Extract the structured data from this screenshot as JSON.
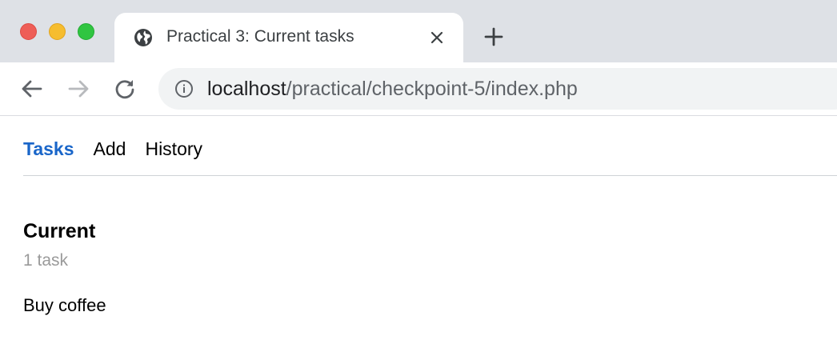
{
  "browser": {
    "tab": {
      "title": "Practical 3: Current tasks",
      "favicon": "globe-icon",
      "close_icon": "close-icon"
    },
    "new_tab_icon": "plus-icon",
    "nav": {
      "back_icon": "arrow-left-icon",
      "forward_icon": "arrow-right-icon",
      "reload_icon": "reload-icon"
    },
    "omnibox": {
      "info_icon": "info-icon",
      "url_host": "localhost",
      "url_path": "/practical/checkpoint-5/index.php"
    },
    "colors": {
      "close": "#ee5e57",
      "minimize": "#f6bd2f",
      "maximize": "#30c541",
      "tabstrip": "#dee1e6",
      "omnibox": "#f1f3f4"
    }
  },
  "page": {
    "nav": [
      {
        "label": "Tasks",
        "active": true
      },
      {
        "label": "Add",
        "active": false
      },
      {
        "label": "History",
        "active": false
      }
    ],
    "section_title": "Current",
    "task_count": "1 task",
    "tasks": [
      {
        "label": "Buy coffee"
      }
    ],
    "colors": {
      "active_link": "#1a66c9",
      "muted_text": "#9a9a9a"
    }
  }
}
